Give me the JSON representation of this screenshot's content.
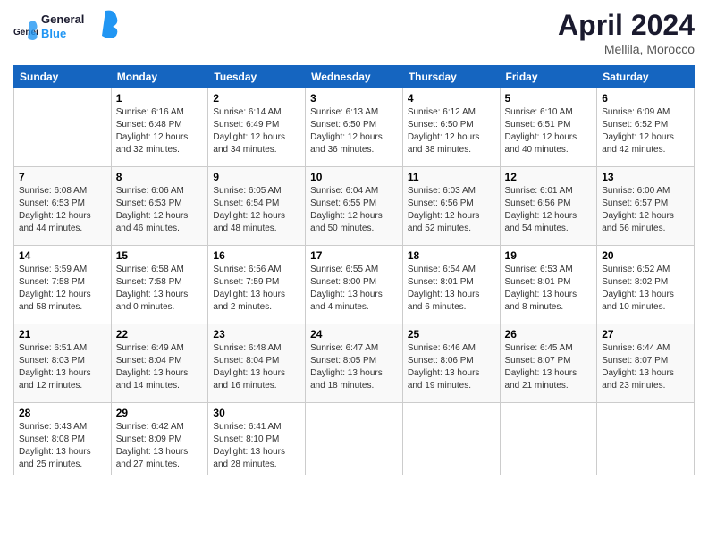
{
  "header": {
    "logo_general": "General",
    "logo_blue": "Blue",
    "month_title": "April 2024",
    "location": "Mellila, Morocco"
  },
  "days_of_week": [
    "Sunday",
    "Monday",
    "Tuesday",
    "Wednesday",
    "Thursday",
    "Friday",
    "Saturday"
  ],
  "weeks": [
    [
      {
        "day": "",
        "sunrise": "",
        "sunset": "",
        "daylight": ""
      },
      {
        "day": "1",
        "sunrise": "6:16 AM",
        "sunset": "6:48 PM",
        "daylight": "12 hours and 32 minutes."
      },
      {
        "day": "2",
        "sunrise": "6:14 AM",
        "sunset": "6:49 PM",
        "daylight": "12 hours and 34 minutes."
      },
      {
        "day": "3",
        "sunrise": "6:13 AM",
        "sunset": "6:50 PM",
        "daylight": "12 hours and 36 minutes."
      },
      {
        "day": "4",
        "sunrise": "6:12 AM",
        "sunset": "6:50 PM",
        "daylight": "12 hours and 38 minutes."
      },
      {
        "day": "5",
        "sunrise": "6:10 AM",
        "sunset": "6:51 PM",
        "daylight": "12 hours and 40 minutes."
      },
      {
        "day": "6",
        "sunrise": "6:09 AM",
        "sunset": "6:52 PM",
        "daylight": "12 hours and 42 minutes."
      }
    ],
    [
      {
        "day": "7",
        "sunrise": "6:08 AM",
        "sunset": "6:53 PM",
        "daylight": "12 hours and 44 minutes."
      },
      {
        "day": "8",
        "sunrise": "6:06 AM",
        "sunset": "6:53 PM",
        "daylight": "12 hours and 46 minutes."
      },
      {
        "day": "9",
        "sunrise": "6:05 AM",
        "sunset": "6:54 PM",
        "daylight": "12 hours and 48 minutes."
      },
      {
        "day": "10",
        "sunrise": "6:04 AM",
        "sunset": "6:55 PM",
        "daylight": "12 hours and 50 minutes."
      },
      {
        "day": "11",
        "sunrise": "6:03 AM",
        "sunset": "6:56 PM",
        "daylight": "12 hours and 52 minutes."
      },
      {
        "day": "12",
        "sunrise": "6:01 AM",
        "sunset": "6:56 PM",
        "daylight": "12 hours and 54 minutes."
      },
      {
        "day": "13",
        "sunrise": "6:00 AM",
        "sunset": "6:57 PM",
        "daylight": "12 hours and 56 minutes."
      }
    ],
    [
      {
        "day": "14",
        "sunrise": "6:59 AM",
        "sunset": "7:58 PM",
        "daylight": "12 hours and 58 minutes."
      },
      {
        "day": "15",
        "sunrise": "6:58 AM",
        "sunset": "7:58 PM",
        "daylight": "13 hours and 0 minutes."
      },
      {
        "day": "16",
        "sunrise": "6:56 AM",
        "sunset": "7:59 PM",
        "daylight": "13 hours and 2 minutes."
      },
      {
        "day": "17",
        "sunrise": "6:55 AM",
        "sunset": "8:00 PM",
        "daylight": "13 hours and 4 minutes."
      },
      {
        "day": "18",
        "sunrise": "6:54 AM",
        "sunset": "8:01 PM",
        "daylight": "13 hours and 6 minutes."
      },
      {
        "day": "19",
        "sunrise": "6:53 AM",
        "sunset": "8:01 PM",
        "daylight": "13 hours and 8 minutes."
      },
      {
        "day": "20",
        "sunrise": "6:52 AM",
        "sunset": "8:02 PM",
        "daylight": "13 hours and 10 minutes."
      }
    ],
    [
      {
        "day": "21",
        "sunrise": "6:51 AM",
        "sunset": "8:03 PM",
        "daylight": "13 hours and 12 minutes."
      },
      {
        "day": "22",
        "sunrise": "6:49 AM",
        "sunset": "8:04 PM",
        "daylight": "13 hours and 14 minutes."
      },
      {
        "day": "23",
        "sunrise": "6:48 AM",
        "sunset": "8:04 PM",
        "daylight": "13 hours and 16 minutes."
      },
      {
        "day": "24",
        "sunrise": "6:47 AM",
        "sunset": "8:05 PM",
        "daylight": "13 hours and 18 minutes."
      },
      {
        "day": "25",
        "sunrise": "6:46 AM",
        "sunset": "8:06 PM",
        "daylight": "13 hours and 19 minutes."
      },
      {
        "day": "26",
        "sunrise": "6:45 AM",
        "sunset": "8:07 PM",
        "daylight": "13 hours and 21 minutes."
      },
      {
        "day": "27",
        "sunrise": "6:44 AM",
        "sunset": "8:07 PM",
        "daylight": "13 hours and 23 minutes."
      }
    ],
    [
      {
        "day": "28",
        "sunrise": "6:43 AM",
        "sunset": "8:08 PM",
        "daylight": "13 hours and 25 minutes."
      },
      {
        "day": "29",
        "sunrise": "6:42 AM",
        "sunset": "8:09 PM",
        "daylight": "13 hours and 27 minutes."
      },
      {
        "day": "30",
        "sunrise": "6:41 AM",
        "sunset": "8:10 PM",
        "daylight": "13 hours and 28 minutes."
      },
      {
        "day": "",
        "sunrise": "",
        "sunset": "",
        "daylight": ""
      },
      {
        "day": "",
        "sunrise": "",
        "sunset": "",
        "daylight": ""
      },
      {
        "day": "",
        "sunrise": "",
        "sunset": "",
        "daylight": ""
      },
      {
        "day": "",
        "sunrise": "",
        "sunset": "",
        "daylight": ""
      }
    ]
  ]
}
